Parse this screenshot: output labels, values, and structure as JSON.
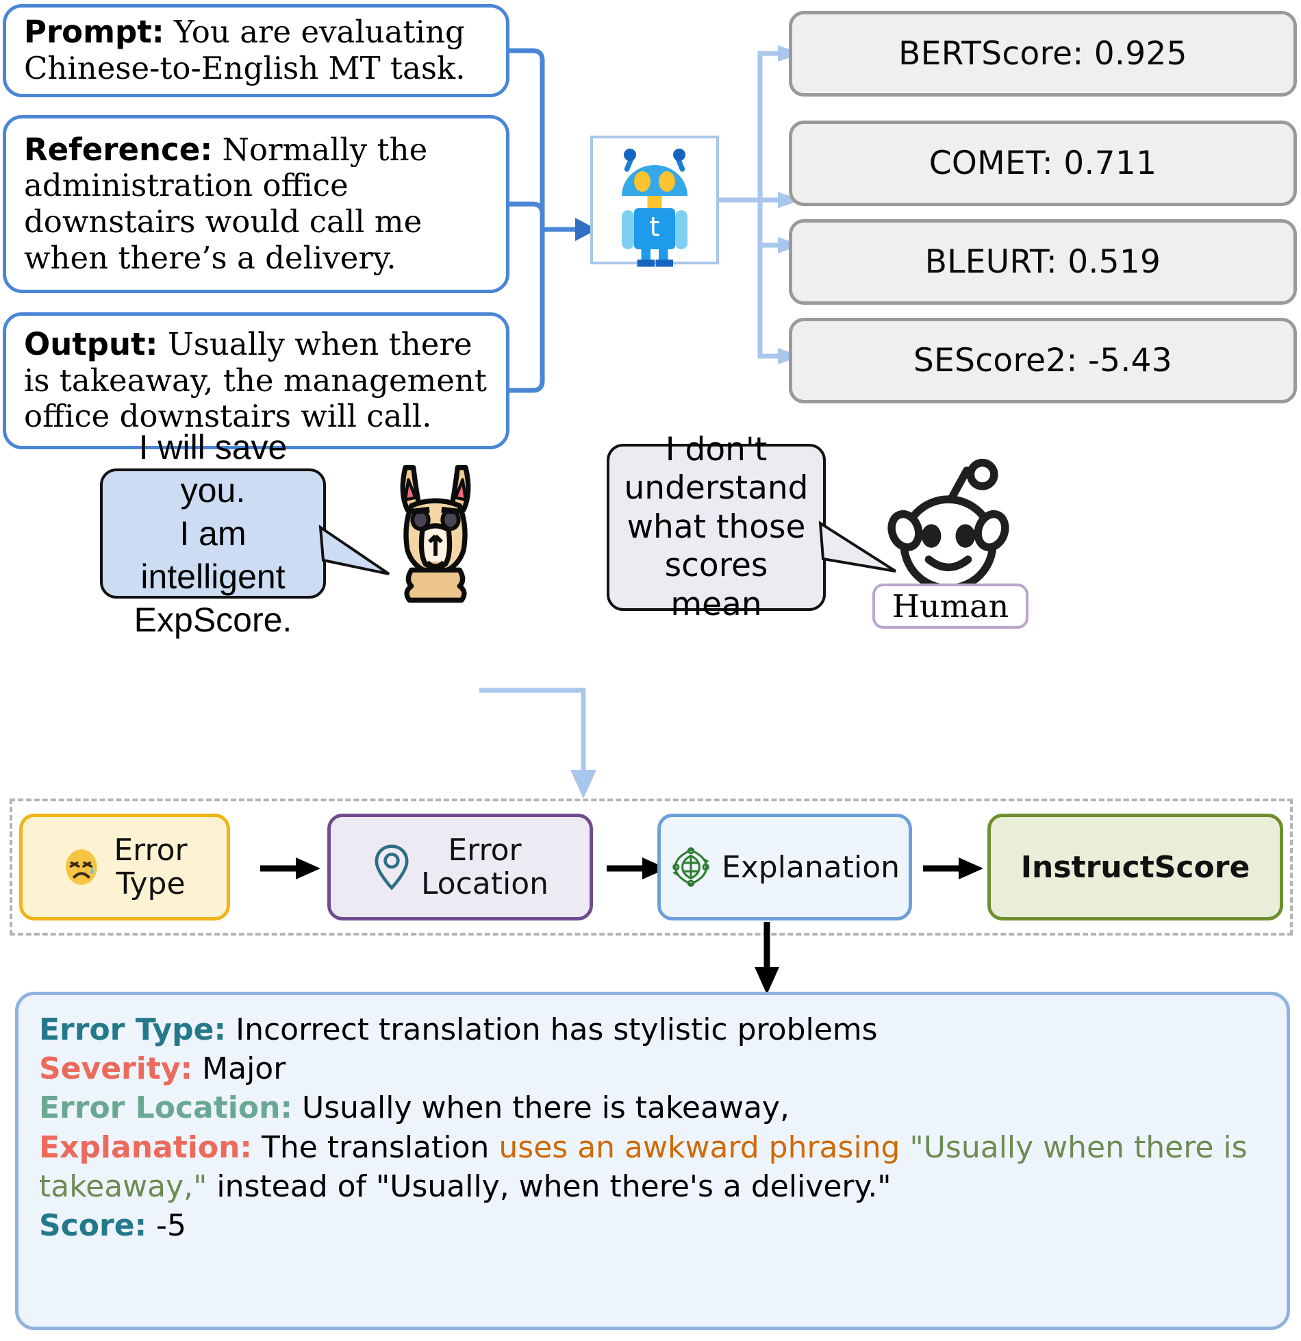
{
  "inputs": [
    {
      "label": "Prompt:",
      "text": "You are evaluating Chinese-to-English MT task."
    },
    {
      "label": "Reference:",
      "text": "Normally the administration office downstairs would call me when there’s a delivery."
    },
    {
      "label": "Output:",
      "text": "Usually when there is takeaway, the management office downstairs will call."
    }
  ],
  "metrics": [
    {
      "name": "BERTScore",
      "value": "0.925",
      "text": "BERTScore: 0.925"
    },
    {
      "name": "COMET",
      "value": "0.711",
      "text": "COMET: 0.711"
    },
    {
      "name": "BLEURT",
      "value": "0.519",
      "text": "BLEURT: 0.519"
    },
    {
      "name": "SEScore2",
      "value": "-5.43",
      "text": "SEScore2: -5.43"
    }
  ],
  "llama_bubble": {
    "line1": "I will save you.",
    "line2": "I am intelligent",
    "line3": "ExpScore."
  },
  "human_bubble": {
    "line1": "I don't",
    "line2": "understand",
    "line3": "what those",
    "line4": "scores mean"
  },
  "human_tag": "Human",
  "pipeline": [
    {
      "id": "error-type",
      "line1": "Error",
      "line2": "Type",
      "icon": "sad-face-icon"
    },
    {
      "id": "error-location",
      "line1": "Error",
      "line2": "Location",
      "icon": "map-pin-icon"
    },
    {
      "id": "explanation",
      "line1": "Explanation",
      "line2": "",
      "icon": "brain-cycle-icon"
    },
    {
      "id": "instructscore",
      "line1": "InstructScore",
      "line2": "",
      "icon": ""
    }
  ],
  "output": {
    "error_type_label": "Error Type:",
    "error_type_value": "Incorrect translation has stylistic problems",
    "severity_label": "Severity:",
    "severity_value": "Major",
    "error_location_label": "Error Location:",
    "error_location_value": "Usually when there is takeaway,",
    "explanation_label": "Explanation:",
    "explanation_p1": "The translation",
    "explanation_highlight1": "uses an awkward phrasing",
    "explanation_quote1": "\"Usually when there is takeaway,\"",
    "explanation_p2": "instead of \"Usually, when there's a delivery.\"",
    "score_label": "Score:",
    "score_value": "-5"
  },
  "colors": {
    "card_border": "#4a86d6",
    "metric_border": "#9a9a9a",
    "metric_bg": "#efefef",
    "arrow_light_blue": "#a9c6ec",
    "teal": "#23798a",
    "red": "#ec6a5c",
    "green": "#6aa893",
    "orange": "#cf6a06",
    "olive": "#6c8c52"
  }
}
